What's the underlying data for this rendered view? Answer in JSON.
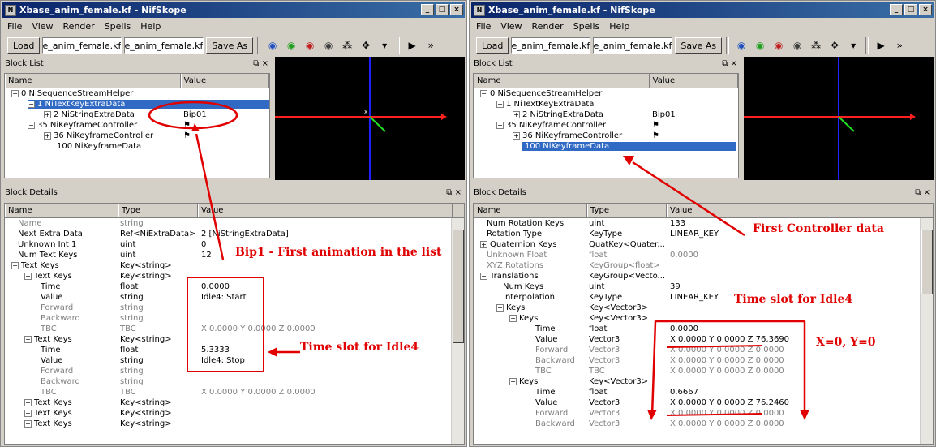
{
  "left": {
    "title": "Xbase_anim_female.kf - NifSkope",
    "menu": [
      "File",
      "View",
      "Render",
      "Spells",
      "Help"
    ],
    "load_label": "Load",
    "input1": "xbase_anim_female.kf",
    "input2": "xbase_anim_female.kf",
    "save_label": "Save As",
    "block_list_title": "Block List",
    "block_details_title": "Block Details",
    "list_cols": [
      "Name",
      "Value"
    ],
    "list_rows": [
      {
        "name": "0 NiSequenceStreamHelper",
        "value": ""
      },
      {
        "name": "1 NiTextKeyExtraData",
        "value": ""
      },
      {
        "name": "2 NiStringExtraData",
        "value": "Bip01"
      },
      {
        "name": "35 NiKeyframeController",
        "value": ""
      },
      {
        "name": "36 NiKeyframeController",
        "value": ""
      },
      {
        "name": "100 NiKeyframeData",
        "value": ""
      }
    ],
    "detail_cols": [
      "Name",
      "Type",
      "Value"
    ],
    "detail_rows": [
      {
        "n": "Name",
        "t": "string",
        "v": ""
      },
      {
        "n": "Next Extra Data",
        "t": "Ref<NiExtraData>",
        "v": "2 [NiStringExtraData]"
      },
      {
        "n": "Unknown Int 1",
        "t": "uint",
        "v": "0"
      },
      {
        "n": "Num Text Keys",
        "t": "uint",
        "v": "12"
      },
      {
        "n": "Text Keys",
        "t": "Key<string>",
        "v": ""
      },
      {
        "n": "Text Keys",
        "t": "Key<string>",
        "v": ""
      },
      {
        "n": "Time",
        "t": "float",
        "v": "0.0000"
      },
      {
        "n": "Value",
        "t": "string",
        "v": "Idle4: Start"
      },
      {
        "n": "Forward",
        "t": "string",
        "v": ""
      },
      {
        "n": "Backward",
        "t": "string",
        "v": ""
      },
      {
        "n": "TBC",
        "t": "TBC",
        "v": "X 0.0000 Y 0.0000 Z 0.0000"
      },
      {
        "n": "Text Keys",
        "t": "Key<string>",
        "v": ""
      },
      {
        "n": "Time",
        "t": "float",
        "v": "5.3333"
      },
      {
        "n": "Value",
        "t": "string",
        "v": "Idle4: Stop"
      },
      {
        "n": "Forward",
        "t": "string",
        "v": ""
      },
      {
        "n": "Backward",
        "t": "string",
        "v": ""
      },
      {
        "n": "TBC",
        "t": "TBC",
        "v": "X 0.0000 Y 0.0000 Z 0.0000"
      },
      {
        "n": "Text Keys",
        "t": "Key<string>",
        "v": ""
      },
      {
        "n": "Text Keys",
        "t": "Key<string>",
        "v": ""
      },
      {
        "n": "Text Keys",
        "t": "Key<string>",
        "v": ""
      }
    ]
  },
  "right": {
    "title": "Xbase_anim_female.kf - NifSkope",
    "menu": [
      "File",
      "View",
      "Render",
      "Spells",
      "Help"
    ],
    "load_label": "Load",
    "input1": "xbase_anim_female.kf",
    "input2": "xbase_anim_female.kf",
    "save_label": "Save As",
    "block_list_title": "Block List",
    "block_details_title": "Block Details",
    "list_cols": [
      "Name",
      "Value"
    ],
    "list_rows": [
      {
        "name": "0 NiSequenceStreamHelper",
        "value": ""
      },
      {
        "name": "1 NiTextKeyExtraData",
        "value": ""
      },
      {
        "name": "2 NiStringExtraData",
        "value": "Bip01"
      },
      {
        "name": "35 NiKeyframeController",
        "value": ""
      },
      {
        "name": "36 NiKeyframeController",
        "value": ""
      },
      {
        "name": "100 NiKeyframeData",
        "value": ""
      }
    ],
    "detail_cols": [
      "Name",
      "Type",
      "Value"
    ],
    "detail_rows": [
      {
        "n": "Num Rotation Keys",
        "t": "uint",
        "v": "133"
      },
      {
        "n": "Rotation Type",
        "t": "KeyType",
        "v": "LINEAR_KEY"
      },
      {
        "n": "Quaternion Keys",
        "t": "QuatKey<Quater...",
        "v": ""
      },
      {
        "n": "Unknown Float",
        "t": "float",
        "v": "0.0000"
      },
      {
        "n": "XYZ Rotations",
        "t": "KeyGroup<float>",
        "v": ""
      },
      {
        "n": "Translations",
        "t": "KeyGroup<Vecto...",
        "v": ""
      },
      {
        "n": "Num Keys",
        "t": "uint",
        "v": "39"
      },
      {
        "n": "Interpolation",
        "t": "KeyType",
        "v": "LINEAR_KEY"
      },
      {
        "n": "Keys",
        "t": "Key<Vector3>",
        "v": ""
      },
      {
        "n": "Keys",
        "t": "Key<Vector3>",
        "v": ""
      },
      {
        "n": "Time",
        "t": "float",
        "v": "0.0000"
      },
      {
        "n": "Value",
        "t": "Vector3",
        "v": "X 0.0000 Y 0.0000 Z 76.3690"
      },
      {
        "n": "Forward",
        "t": "Vector3",
        "v": "X 0.0000 Y 0.0000 Z 0.0000"
      },
      {
        "n": "Backward",
        "t": "Vector3",
        "v": "X 0.0000 Y 0.0000 Z 0.0000"
      },
      {
        "n": "TBC",
        "t": "TBC",
        "v": "X 0.0000 Y 0.0000 Z 0.0000"
      },
      {
        "n": "Keys",
        "t": "Key<Vector3>",
        "v": ""
      },
      {
        "n": "Time",
        "t": "float",
        "v": "0.6667"
      },
      {
        "n": "Value",
        "t": "Vector3",
        "v": "X 0.0000 Y 0.0000 Z 76.2460"
      },
      {
        "n": "Forward",
        "t": "Vector3",
        "v": "X 0.0000 Y 0.0000 Z 0.0000"
      },
      {
        "n": "Backward",
        "t": "Vector3",
        "v": "X 0.0000 Y 0.0000 Z 0.0000"
      }
    ]
  },
  "annotations": {
    "bip": "Bip1 - First animation in the list",
    "idle_left": "Time slot for Idle4",
    "controller": "First Controller data",
    "idle_right": "Time slot for Idle4",
    "xy": "X=0, Y=0"
  },
  "colors": {
    "annotation": "#e00000",
    "selection": "#316ac5",
    "title": "#0a246a"
  }
}
